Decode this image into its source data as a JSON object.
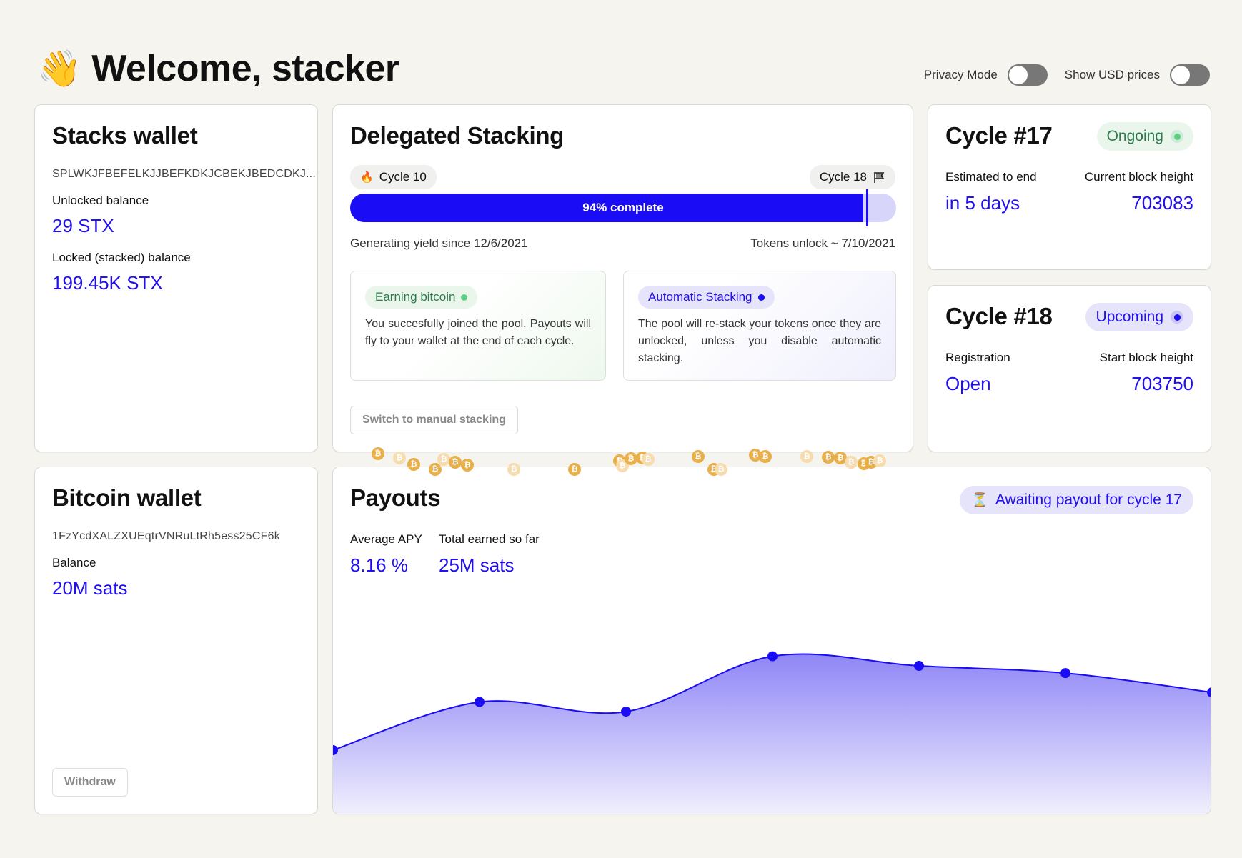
{
  "header": {
    "title": "Welcome, stacker",
    "wave_icon": "👋"
  },
  "toggles": {
    "privacy": {
      "label": "Privacy Mode",
      "on": false
    },
    "usd": {
      "label": "Show USD prices",
      "on": false
    }
  },
  "stacks_wallet": {
    "title": "Stacks wallet",
    "address": "SPLWKJFBEFELKJJBEFKDKJCBEKJBEDCDKJ...",
    "unlocked_label": "Unlocked balance",
    "unlocked_value": "29 STX",
    "locked_label": "Locked (stacked) balance",
    "locked_value": "199.45K STX"
  },
  "delegated": {
    "title": "Delegated Stacking",
    "start_cycle": "Cycle 10",
    "end_cycle": "Cycle 18",
    "progress": 0.94,
    "progress_label": "94% complete",
    "since": "Generating yield since 12/6/2021",
    "unlock": "Tokens unlock ~ 7/10/2021",
    "earning": {
      "badge": "Earning bitcoin",
      "desc": "You succesfully joined the pool. Payouts will fly to your wallet at the end of each cycle."
    },
    "auto": {
      "badge": "Automatic Stacking",
      "desc": "The pool will re-stack your tokens once they are unlocked, unless you disable automatic stacking."
    },
    "manual_button": "Switch to manual stacking"
  },
  "cycle17": {
    "title": "Cycle #17",
    "status": "Ongoing",
    "left_label": "Estimated to end",
    "left_value": "in 5 days",
    "right_label": "Current block height",
    "right_value": "703083"
  },
  "cycle18": {
    "title": "Cycle #18",
    "status": "Upcoming",
    "left_label": "Registration",
    "left_value": "Open",
    "right_label": "Start block height",
    "right_value": "703750"
  },
  "bitcoin_wallet": {
    "title": "Bitcoin wallet",
    "address": "1FzYcdXALZXUEqtrVNRuLtRh5ess25CF6k",
    "balance_label": "Balance",
    "balance_value": "20M sats",
    "withdraw_button": "Withdraw"
  },
  "payouts": {
    "title": "Payouts",
    "awaiting": "Awaiting payout for cycle 17",
    "apy_label": "Average APY",
    "apy_value": "8.16 %",
    "earned_label": "Total earned so far",
    "earned_value": "25M sats"
  },
  "colors": {
    "accent": "#1a0cf5",
    "green": "#2e9b5e",
    "coin": "#e8b04a"
  },
  "chart_data": {
    "type": "area",
    "x": [
      0,
      1,
      2,
      3,
      4,
      5,
      6
    ],
    "values": [
      0.27,
      0.47,
      0.43,
      0.66,
      0.62,
      0.59,
      0.51
    ],
    "ylim": [
      0,
      1
    ],
    "grid": false
  }
}
